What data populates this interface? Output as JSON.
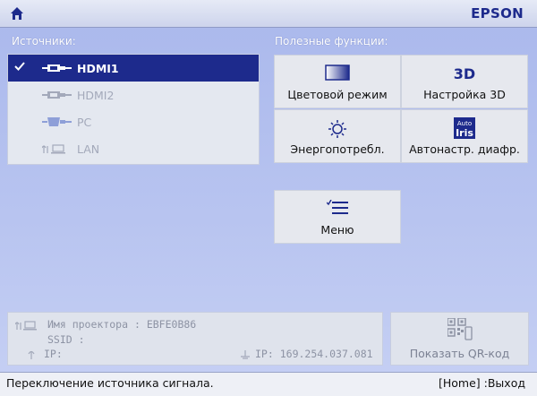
{
  "header": {
    "brand": "EPSON",
    "home_icon": "home-icon"
  },
  "sources": {
    "title": "Источники:",
    "items": [
      {
        "label": "HDMI1",
        "selected": true,
        "icon": "hdmi-icon"
      },
      {
        "label": "HDMI2",
        "selected": false,
        "icon": "hdmi-icon"
      },
      {
        "label": "PC",
        "selected": false,
        "icon": "vga-icon"
      },
      {
        "label": "LAN",
        "selected": false,
        "icon": "network-icon"
      }
    ]
  },
  "features": {
    "title": "Полезные функции:",
    "items": [
      {
        "label": "Цветовой режим",
        "icon": "color-mode-icon"
      },
      {
        "label": "Настройка 3D",
        "icon": "3d-icon",
        "icon_text": "3D"
      },
      {
        "label": "Энергопотребл.",
        "icon": "power-consumption-icon"
      },
      {
        "label": "Автонастр. диафр.",
        "icon": "auto-iris-icon",
        "icon_text_top": "Auto",
        "icon_text_bottom": "Iris"
      },
      {
        "label": "Меню",
        "icon": "menu-list-icon"
      }
    ]
  },
  "info": {
    "projector_name_label": "Имя проектора",
    "projector_name_value": "EBFE0B86",
    "separator": ":",
    "ssid_label": "SSID :",
    "ip_label_left": "IP:",
    "ip_label_right": "IP:",
    "ip_value": "169.254.037.081"
  },
  "qr": {
    "label": "Показать QR-код",
    "icon": "qr-code-icon"
  },
  "status": {
    "message": "Переключение источника сигнала.",
    "exit_hint": "[Home] :Выход"
  },
  "colors": {
    "accent": "#1d2a8c",
    "background": "#b8c4f0"
  }
}
